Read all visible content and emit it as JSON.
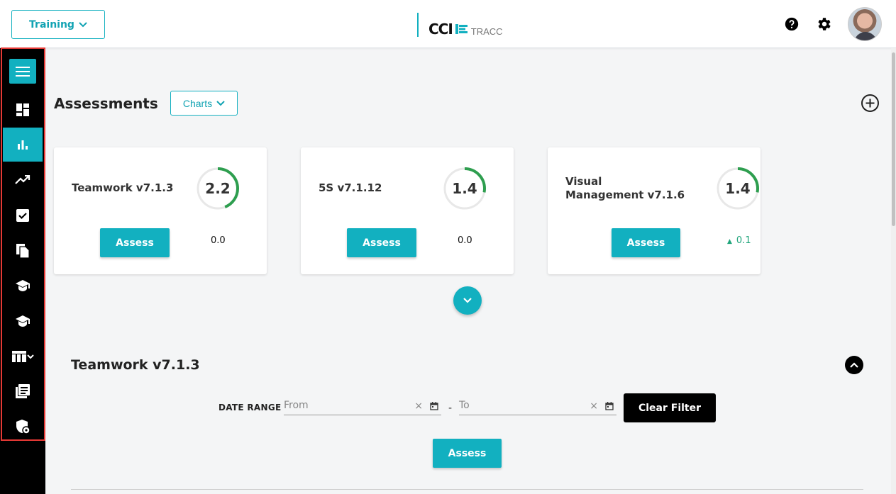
{
  "header": {
    "workspace_label": "Training",
    "logo_text": "CCI",
    "logo_subtext": "TRACC"
  },
  "colors": {
    "accent": "#12b0c0",
    "gauge_green": "#2e9e4f",
    "delta_up": "#1ea47a"
  },
  "sidebar": {
    "items": [
      {
        "icon": "dashboard-icon"
      },
      {
        "icon": "bar-chart-icon",
        "active": true
      },
      {
        "icon": "trending-up-icon"
      },
      {
        "icon": "checkbox-icon"
      },
      {
        "icon": "documents-icon"
      },
      {
        "icon": "graduation-cap-icon"
      },
      {
        "icon": "graduation-cap-icon"
      },
      {
        "icon": "table-chevron-icon"
      },
      {
        "icon": "library-books-icon"
      },
      {
        "icon": "shield-icon"
      }
    ]
  },
  "main": {
    "title": "Assessments",
    "charts_label": "Charts",
    "cards": [
      {
        "title_lines": [
          "Teamwork v7.1.3"
        ],
        "score": "2.2",
        "progress": 0.44,
        "button": "Assess",
        "delta": "0.0",
        "delta_up": false
      },
      {
        "title_lines": [
          "5S v7.1.12"
        ],
        "score": "1.4",
        "progress": 0.28,
        "button": "Assess",
        "delta": "0.0",
        "delta_up": false
      },
      {
        "title_lines": [
          "Visual",
          "Management v7.1.6"
        ],
        "score": "1.4",
        "progress": 0.28,
        "button": "Assess",
        "delta": "0.1",
        "delta_up": true
      }
    ]
  },
  "detail": {
    "title": "Teamwork v7.1.3",
    "date_range_label": "DATE RANGE",
    "from_placeholder": "From",
    "to_placeholder": "To",
    "dash": "-",
    "clear_symbol": "×",
    "clear_filter_label": "Clear Filter",
    "assess_label": "Assess"
  }
}
